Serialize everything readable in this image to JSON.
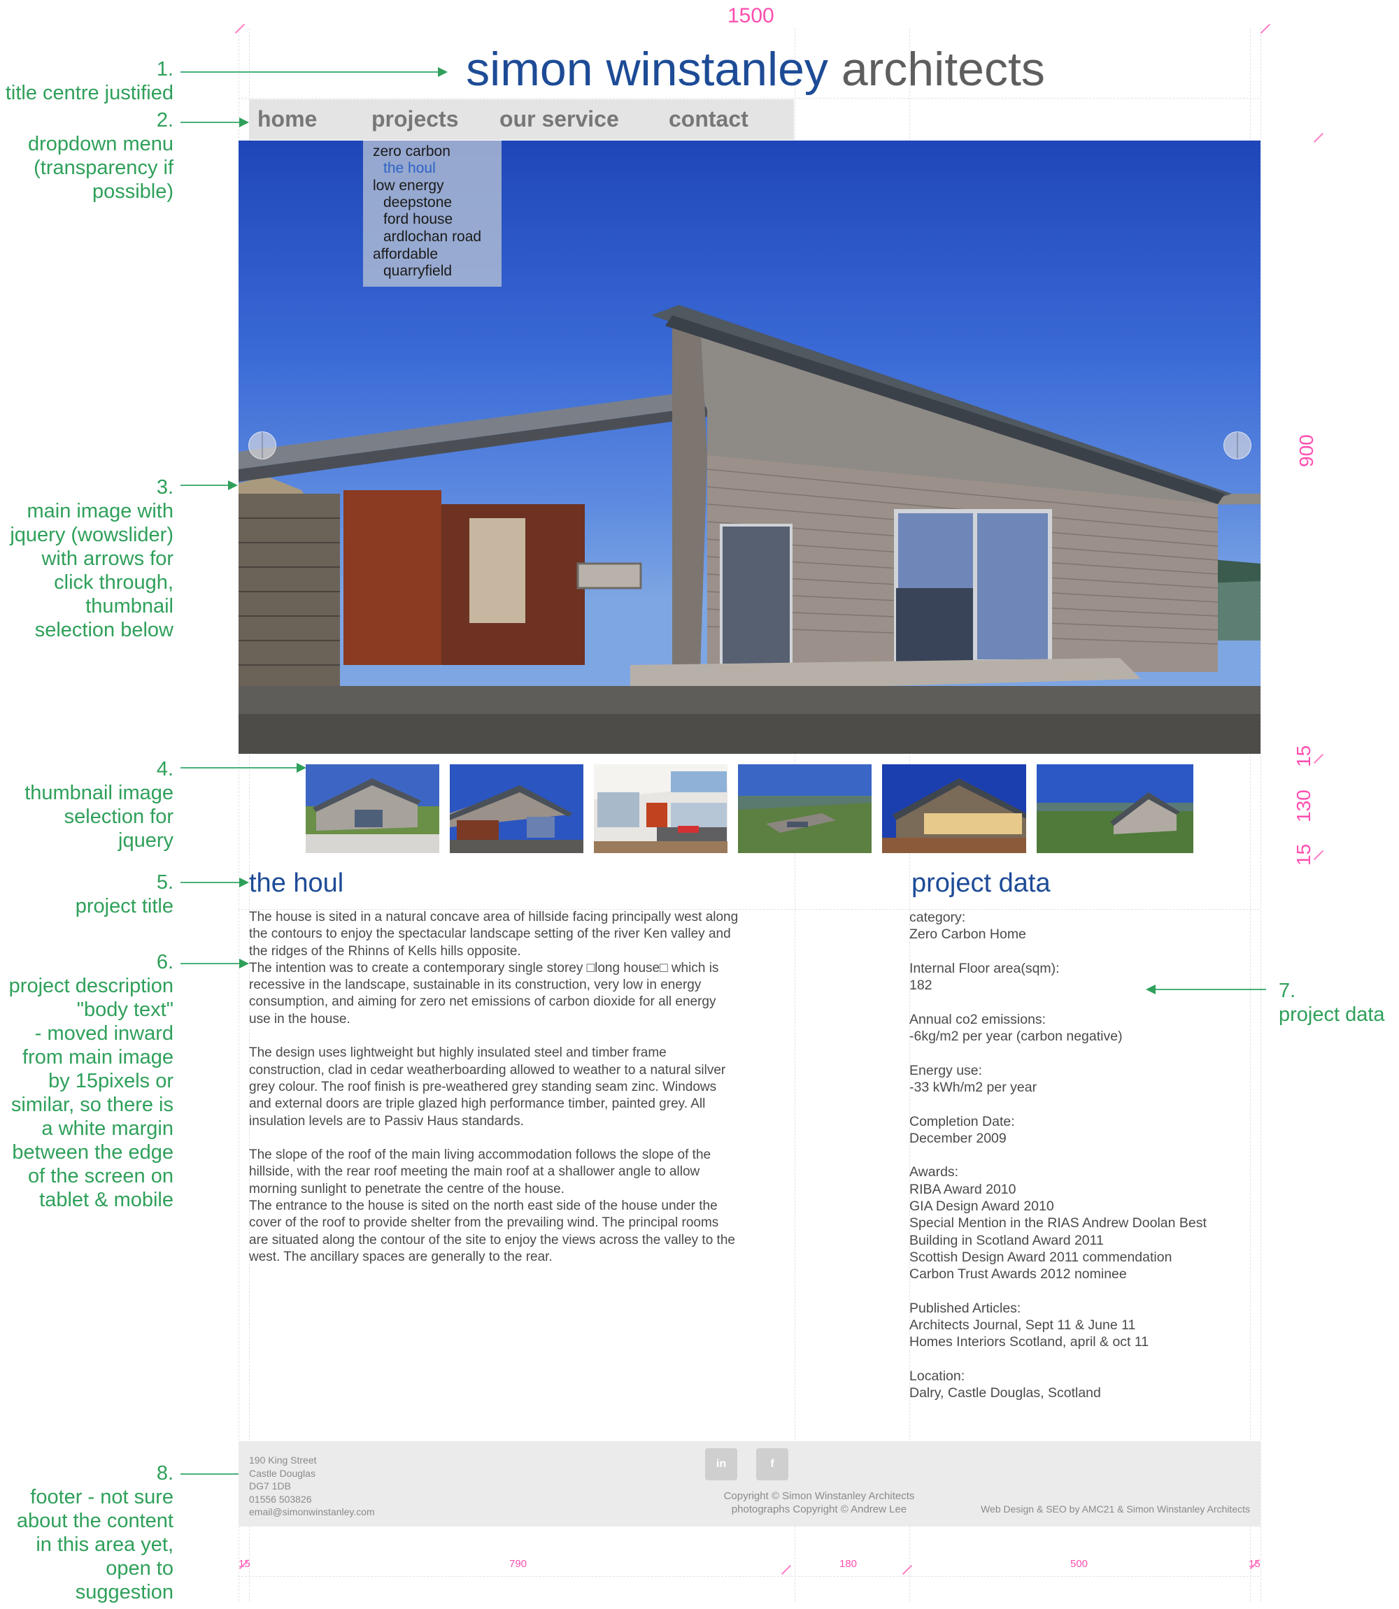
{
  "colors": {
    "brand_blue": "#1d4b96",
    "title_grey": "#5e5e5e",
    "annotation_green": "#2fa05a",
    "dimension_pink": "#ff4fb0",
    "nav_bg": "#e4e4e4",
    "footer_bg": "#ebebeb"
  },
  "dimensions": {
    "total_width": "1500",
    "hero_height": "900",
    "gap_top": "15",
    "thumb_row": "130",
    "gap_bottom": "15",
    "col_margin_left": "15",
    "col_body": "790",
    "col_gap": "180",
    "col_data": "500",
    "col_margin_right": "15"
  },
  "annotations": [
    "1.\ntitle centre justified",
    "2.\ndropdown menu\n(transparency if\npossible)",
    "3.\nmain image with\njquery (wowslider)\nwith arrows for\nclick through,\nthumbnail\nselection below",
    "4.\nthumbnail image\nselection for\njquery",
    "5.\nproject title",
    "6.\nproject description\n\"body text\"\n- moved inward\nfrom main image\nby 15pixels or\nsimilar, so there is\na white margin\nbetween the edge\nof the screen on\ntablet & mobile",
    "7.\nproject data",
    "8.\nfooter - not sure\nabout the content\nin this area yet,\nopen to\nsuggestion"
  ],
  "site": {
    "title_part1": "simon winstanley",
    "title_part2": "architects"
  },
  "nav": {
    "items": [
      "home",
      "projects",
      "our service",
      "contact"
    ]
  },
  "dropdown": {
    "items": [
      {
        "label": "zero carbon",
        "indent": false,
        "active": false
      },
      {
        "label": "the houl",
        "indent": true,
        "active": true
      },
      {
        "label": "low energy",
        "indent": false,
        "active": false
      },
      {
        "label": "deepstone",
        "indent": true,
        "active": false
      },
      {
        "label": "ford house",
        "indent": true,
        "active": false
      },
      {
        "label": "ardlochan road",
        "indent": true,
        "active": false
      },
      {
        "label": "affordable",
        "indent": false,
        "active": false
      },
      {
        "label": "quarryfield",
        "indent": true,
        "active": false
      }
    ]
  },
  "thumbnails": [
    {
      "name": "thumbnail-1"
    },
    {
      "name": "thumbnail-2"
    },
    {
      "name": "thumbnail-3"
    },
    {
      "name": "thumbnail-4"
    },
    {
      "name": "thumbnail-5"
    },
    {
      "name": "thumbnail-6"
    }
  ],
  "project": {
    "title": "the houl",
    "data_heading": "project data",
    "description": "The house is sited in a natural concave area of hillside facing principally west along\nthe contours to enjoy the spectacular landscape setting of the river Ken valley and\nthe ridges of the Rhinns of Kells hills opposite.\nThe intention was to create a contemporary single storey □long house□ which is\nrecessive in the landscape, sustainable in its construction, very low in energy\nconsumption, and aiming for zero net emissions of carbon dioxide for all energy\nuse in the house.\n\nThe design uses lightweight but highly insulated steel and timber frame\nconstruction, clad in cedar weatherboarding allowed to weather to a natural silver\ngrey colour. The roof finish is pre-weathered grey standing seam zinc. Windows\nand external doors are triple glazed high performance timber, painted grey. All\ninsulation levels are to Passiv Haus standards.\n\nThe slope of the roof of the main living accommodation follows the slope of the\nhillside, with the rear roof meeting the main roof at a shallower angle to allow\nmorning sunlight to penetrate the centre of the house.\nThe entrance to the house is sited on the north east side of the house under the\ncover of the roof to provide shelter from the prevailing wind. The principal rooms\nare situated along the contour of the site to enjoy the views across the valley to the\nwest. The ancillary spaces are generally to the rear.",
    "data": "category:\nZero Carbon Home\n\nInternal Floor area(sqm):\n182\n\nAnnual co2 emissions:\n-6kg/m2 per year (carbon negative)\n\nEnergy use:\n-33  kWh/m2 per year\n\nCompletion Date:\nDecember 2009\n\nAwards:\nRIBA Award 2010\nGIA Design Award 2010\nSpecial Mention in the RIAS Andrew Doolan Best\nBuilding in Scotland Award 2011\nScottish Design Award 2011 commendation\nCarbon Trust Awards 2012 nominee\n\nPublished Articles:\nArchitects Journal, Sept 11 & June 11\nHomes Interiors Scotland, april & oct 11\n\nLocation:\nDalry, Castle Douglas, Scotland"
  },
  "footer": {
    "address": "190 King Street\nCastle Douglas\nDG7 1DB\n01556 503826\nemail@simonwinstanley.com",
    "copyright": "Copyright © Simon Winstanley Architects\nphotographs Copyright © Andrew Lee",
    "credit": "Web Design & SEO by AMC21 & Simon Winstanley Architects",
    "linkedin_label": "in",
    "facebook_label": "f"
  }
}
